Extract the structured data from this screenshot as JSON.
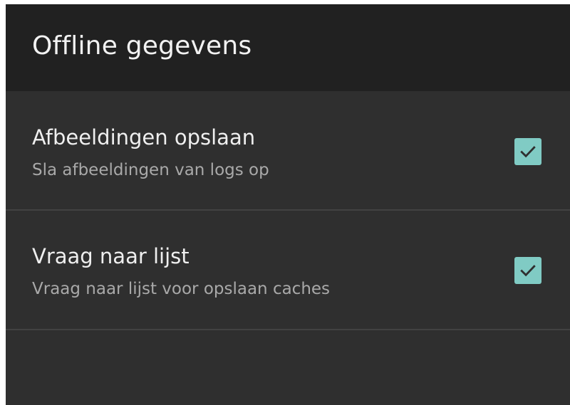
{
  "header": {
    "title": "Offline gegevens"
  },
  "preferences": [
    {
      "title": "Afbeeldingen opslaan",
      "summary": "Sla afbeeldingen van logs op",
      "checked": true
    },
    {
      "title": "Vraag naar lijst",
      "summary": "Vraag naar lijst voor opslaan caches",
      "checked": true
    }
  ],
  "colors": {
    "header_background": "#212121",
    "content_background": "#2f2f2f",
    "checkbox_accent": "#80cbc4",
    "divider": "#424242"
  }
}
